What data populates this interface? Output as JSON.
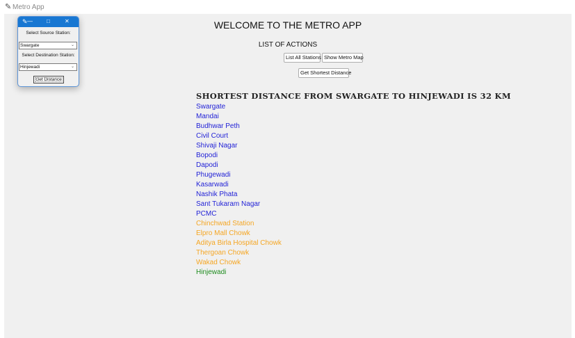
{
  "window": {
    "title": "Metro App",
    "icon": "feather-icon"
  },
  "main": {
    "welcome": "WELCOME TO THE METRO APP",
    "actions_heading": "LIST OF ACTIONS",
    "buttons": {
      "list_all": "List All Stations",
      "show_map": "Show Metro Map",
      "shortest": "Get Shortest Distance"
    },
    "result_title": "SHORTEST DISTANCE FROM SWARGATE TO HINJEWADI IS 32 KM",
    "stations": [
      {
        "name": "Swargate",
        "color": "#1f1fd6"
      },
      {
        "name": "Mandai",
        "color": "#1f1fd6"
      },
      {
        "name": "Budhwar Peth",
        "color": "#1f1fd6"
      },
      {
        "name": "Civil Court",
        "color": "#1f1fd6"
      },
      {
        "name": "Shivaji Nagar",
        "color": "#1f1fd6"
      },
      {
        "name": "Bopodi",
        "color": "#1f1fd6"
      },
      {
        "name": "Dapodi",
        "color": "#1f1fd6"
      },
      {
        "name": "Phugewadi",
        "color": "#1f1fd6"
      },
      {
        "name": "Kasarwadi",
        "color": "#1f1fd6"
      },
      {
        "name": "Nashik Phata",
        "color": "#1f1fd6"
      },
      {
        "name": "Sant Tukaram Nagar",
        "color": "#1f1fd6"
      },
      {
        "name": "PCMC",
        "color": "#1f1fd6"
      },
      {
        "name": "Chinchwad Station",
        "color": "#f5a623"
      },
      {
        "name": "Elpro Mall Chowk",
        "color": "#f5a623"
      },
      {
        "name": "Aditya Birla Hospital Chowk",
        "color": "#f5a623"
      },
      {
        "name": "Thergoan Chowk",
        "color": "#f5a623"
      },
      {
        "name": "Wakad Chowk",
        "color": "#f5a623"
      },
      {
        "name": "Hinjewadi",
        "color": "#1e8c1e"
      }
    ]
  },
  "popup": {
    "source_label": "Select Source Station:",
    "source_value": "Swargate",
    "destination_label": "Select Destination Station:",
    "destination_value": "Hinjewadi",
    "button_label": "Get Distance",
    "titlebar_color": "#1877d2"
  }
}
